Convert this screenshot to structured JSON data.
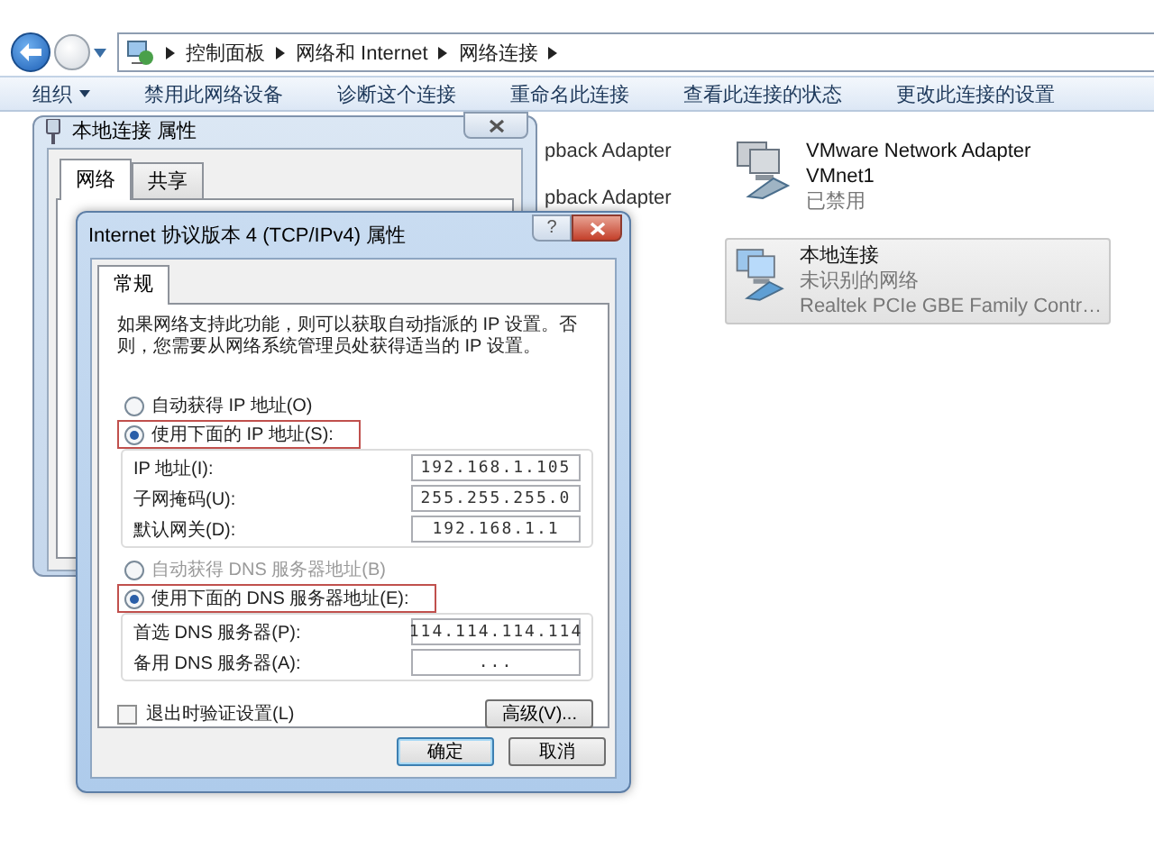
{
  "explorer": {
    "breadcrumbs": [
      "控制面板",
      "网络和 Internet",
      "网络连接"
    ],
    "toolbar": [
      {
        "label": "组织",
        "kind": "menu"
      },
      {
        "label": "禁用此网络设备",
        "kind": "command"
      },
      {
        "label": "诊断这个连接",
        "kind": "command"
      },
      {
        "label": "重命名此连接",
        "kind": "command"
      },
      {
        "label": "查看此连接的状态",
        "kind": "command"
      },
      {
        "label": "更改此连接的设置",
        "kind": "command"
      }
    ],
    "partial_items": [
      "pback Adapter",
      "pback Adapter"
    ],
    "adapters": [
      {
        "name": "VMware Network Adapter VMnet1",
        "status": "已禁用",
        "selected": false,
        "disabled": true
      },
      {
        "name": "本地连接",
        "status": "未识别的网络",
        "device": "Realtek PCIe GBE Family Contr…",
        "selected": true,
        "disabled": false
      }
    ]
  },
  "local_dialog": {
    "title": "本地连接 属性",
    "tabs": [
      {
        "label": "网络",
        "selected": true
      },
      {
        "label": "共享",
        "selected": false
      }
    ]
  },
  "ipv4_dialog": {
    "title": "Internet 协议版本 4 (TCP/IPv4) 属性",
    "help": "?",
    "tabs": [
      {
        "label": "常规",
        "selected": true
      }
    ],
    "description": "如果网络支持此功能，则可以获取自动指派的 IP 设置。否则，您需要从网络系统管理员处获得适当的 IP 设置。",
    "ip_options": [
      {
        "label": "自动获得 IP 地址(O)",
        "selected": false,
        "disabled": false,
        "highlighted": false
      },
      {
        "label": "使用下面的 IP 地址(S):",
        "selected": true,
        "disabled": false,
        "highlighted": true
      }
    ],
    "ip_fields": [
      {
        "label": "IP 地址(I):",
        "value": "192.168.1.105"
      },
      {
        "label": "子网掩码(U):",
        "value": "255.255.255.0"
      },
      {
        "label": "默认网关(D):",
        "value": "192.168.1.1"
      }
    ],
    "dns_options": [
      {
        "label": "自动获得 DNS 服务器地址(B)",
        "selected": false,
        "disabled": true,
        "highlighted": false
      },
      {
        "label": "使用下面的 DNS 服务器地址(E):",
        "selected": true,
        "disabled": false,
        "highlighted": true
      }
    ],
    "dns_fields": [
      {
        "label": "首选 DNS 服务器(P):",
        "value": "114.114.114.114"
      },
      {
        "label": "备用 DNS 服务器(A):",
        "value": "..."
      }
    ],
    "validate": {
      "label": "退出时验证设置(L)",
      "checked": false
    },
    "advanced_button": "高级(V)...",
    "buttons": [
      {
        "label": "确定",
        "default": true
      },
      {
        "label": "取消",
        "default": false
      }
    ]
  }
}
